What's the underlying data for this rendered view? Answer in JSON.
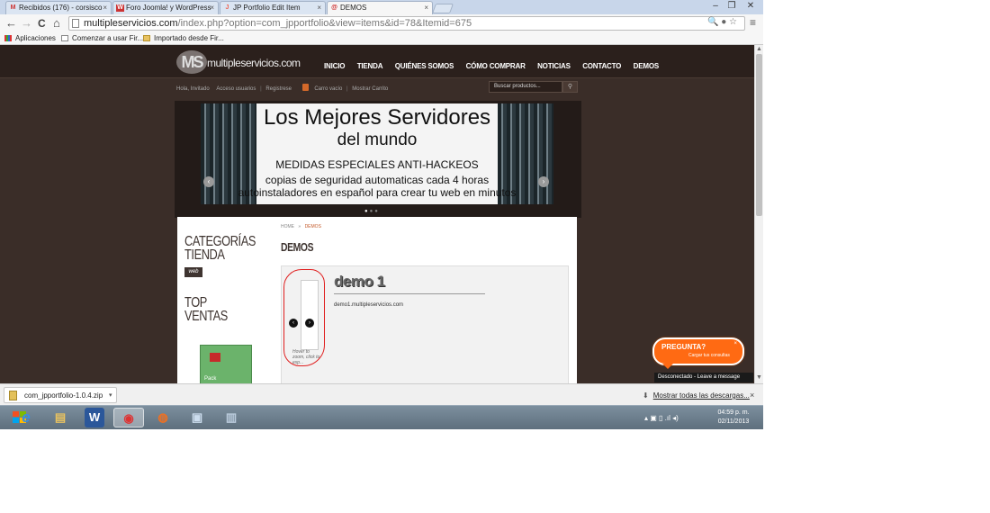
{
  "browser": {
    "tabs": [
      {
        "icon": "M",
        "label": "Recibidos (176) - corsisco",
        "active": false
      },
      {
        "icon": "W",
        "label": "Foro Joomla! y WordPress",
        "active": false
      },
      {
        "icon": "J",
        "label": "JP Portfolio Edit Item",
        "active": false
      },
      {
        "icon": "@",
        "label": "DEMOS",
        "active": true
      }
    ],
    "tab_close": "×",
    "window_controls": {
      "minimize": "–",
      "restore": "❐",
      "close": "✕"
    },
    "nav": {
      "back": "←",
      "forward": "→",
      "reload": "C",
      "home": "⌂"
    },
    "url_host": "multipleservicios.com",
    "url_path": "/index.php?option=com_jpportfolio&view=items&id=78&Itemid=675",
    "omni_icons": "🔍 ● ☆",
    "menu_icon": "≡",
    "bookmarks": [
      {
        "label": "Aplicaciones"
      },
      {
        "label": "Comenzar a usar Fir..."
      },
      {
        "label": "Importado desde Fir..."
      }
    ]
  },
  "site": {
    "logo_initials": "MS",
    "logo_text": "multipleservicios.com",
    "nav": [
      "INICIO",
      "TIENDA",
      "QUIÉNES SOMOS",
      "CÓMO COMPRAR",
      "NOTICIAS",
      "CONTACTO",
      "DEMOS"
    ],
    "userbar": {
      "greeting": "Hola, Invitado",
      "login": "Acceso usuarios",
      "register": "Registrese",
      "cart": "Carro vacío",
      "show_cart": "Mostrar Carrito",
      "separator": "|"
    },
    "search_placeholder": "Buscar productos...",
    "search_icon": "⚲",
    "slider": {
      "line1": "Los Mejores Servidores",
      "line2": "del mundo",
      "line3": "MEDIDAS ESPECIALES ANTI-HACKEOS",
      "line4": "copias de seguridad automaticas cada 4 horas",
      "line5": "autoinstaladores en español para crear tu web en minutos",
      "prev": "‹",
      "next": "›",
      "dots": [
        "●",
        "●",
        "●"
      ]
    },
    "sidebar": {
      "categories_title_1": "CATEGORÍAS",
      "categories_title_2": "TIENDA",
      "category_badge": "web",
      "top_title_1": "TOP",
      "top_title_2": "VENTAS",
      "product_label": "Pack"
    },
    "breadcrumb": {
      "home": "HOME",
      "sep": "»",
      "current": "DEMOS"
    },
    "page_title": "DEMOS",
    "portfolio": {
      "item_title": "demo 1",
      "item_url": "demo1.multipleservicios.com",
      "prev": "‹",
      "next": "›",
      "hover_text_1": "Hover to",
      "hover_text_2": "zoom, click to",
      "hover_text_3": "exp..."
    },
    "chat": {
      "title": "PREGUNTA?",
      "subtitle": "Cargar tus consultas",
      "close": "×",
      "status": "Desconectado - Leave a message"
    }
  },
  "downloads": {
    "file": "com_jpportfolio-1.0.4.zip",
    "caret": "▾",
    "show_all": "Mostrar todas las descargas...",
    "download_icon": "⬇",
    "close": "×"
  },
  "taskbar": {
    "apps": [
      {
        "icon": "e",
        "name": "internet-explorer"
      },
      {
        "icon": "▤",
        "name": "file-explorer"
      },
      {
        "icon": "W",
        "name": "word"
      },
      {
        "icon": "◉",
        "name": "chrome"
      },
      {
        "icon": "◍",
        "name": "firefox"
      },
      {
        "icon": "▣",
        "name": "network-app"
      },
      {
        "icon": "▥",
        "name": "notepad"
      }
    ],
    "tray": "▴  ▣  ▯  .ıl  ◂)",
    "time": "04:59 p. m.",
    "date": "02/11/2013"
  }
}
